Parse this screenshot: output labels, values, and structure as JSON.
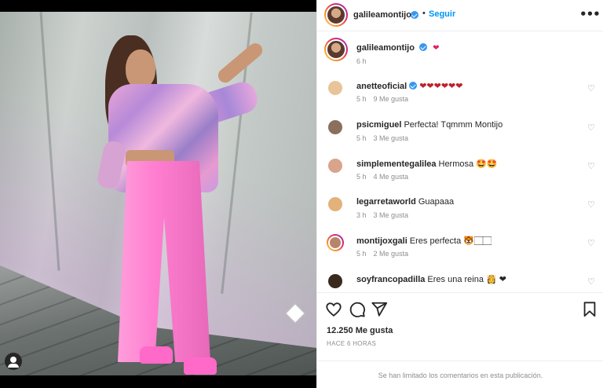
{
  "post": {
    "username": "galileamontijo",
    "follow_label": "Seguir",
    "dot": "•",
    "more_icon": "more-horizontal-icon",
    "more_label": "•••",
    "caption": {
      "username": "galileamontijo",
      "emoji": "❤",
      "time": "6 h"
    }
  },
  "comments": [
    {
      "username": "anetteoficial",
      "text": "❤❤❤❤❤❤",
      "time": "5 h",
      "likes": "9 Me gusta",
      "verified": true,
      "avatar_color": "#e9c39a"
    },
    {
      "username": "psicmiguel",
      "text": "Perfecta! Tqmmm Montijo",
      "time": "5 h",
      "likes": "3 Me gusta",
      "verified": false,
      "avatar_color": "#8a6f5c"
    },
    {
      "username": "simplementegalilea",
      "text": "Hermosa 🤩🤩",
      "time": "5 h",
      "likes": "4 Me gusta",
      "verified": false,
      "avatar_color": "#d9a48c"
    },
    {
      "username": "legarretaworld",
      "text": "Guapaaa",
      "time": "3 h",
      "likes": "3 Me gusta",
      "verified": false,
      "avatar_color": "#e2b27a"
    },
    {
      "username": "montijoxgali",
      "text": "Eres perfecta 🐯🏻🏻",
      "time": "5 h",
      "likes": "2 Me gusta",
      "verified": false,
      "avatar_color": "#b7866a"
    },
    {
      "username": "soyfrancopadilla",
      "text": "Eres una reina 👸 ❤",
      "time": "",
      "likes": "",
      "verified": false,
      "avatar_color": "#3a2a1e"
    }
  ],
  "actions": {
    "like_icon": "heart-icon",
    "comment_icon": "comment-icon",
    "share_icon": "send-icon",
    "save_icon": "bookmark-icon",
    "likes_count": "12.250 Me gusta",
    "posted_ago": "HACE 6 HORAS",
    "limit_note": "Se han limitado los comentarios en esta publicación."
  },
  "comment_like_icon": "♡",
  "colors": {
    "link_blue": "#0095f6",
    "verified_blue": "#3897f0",
    "muted_text": "#8e8e8e",
    "heart_red": "#e0245e"
  }
}
